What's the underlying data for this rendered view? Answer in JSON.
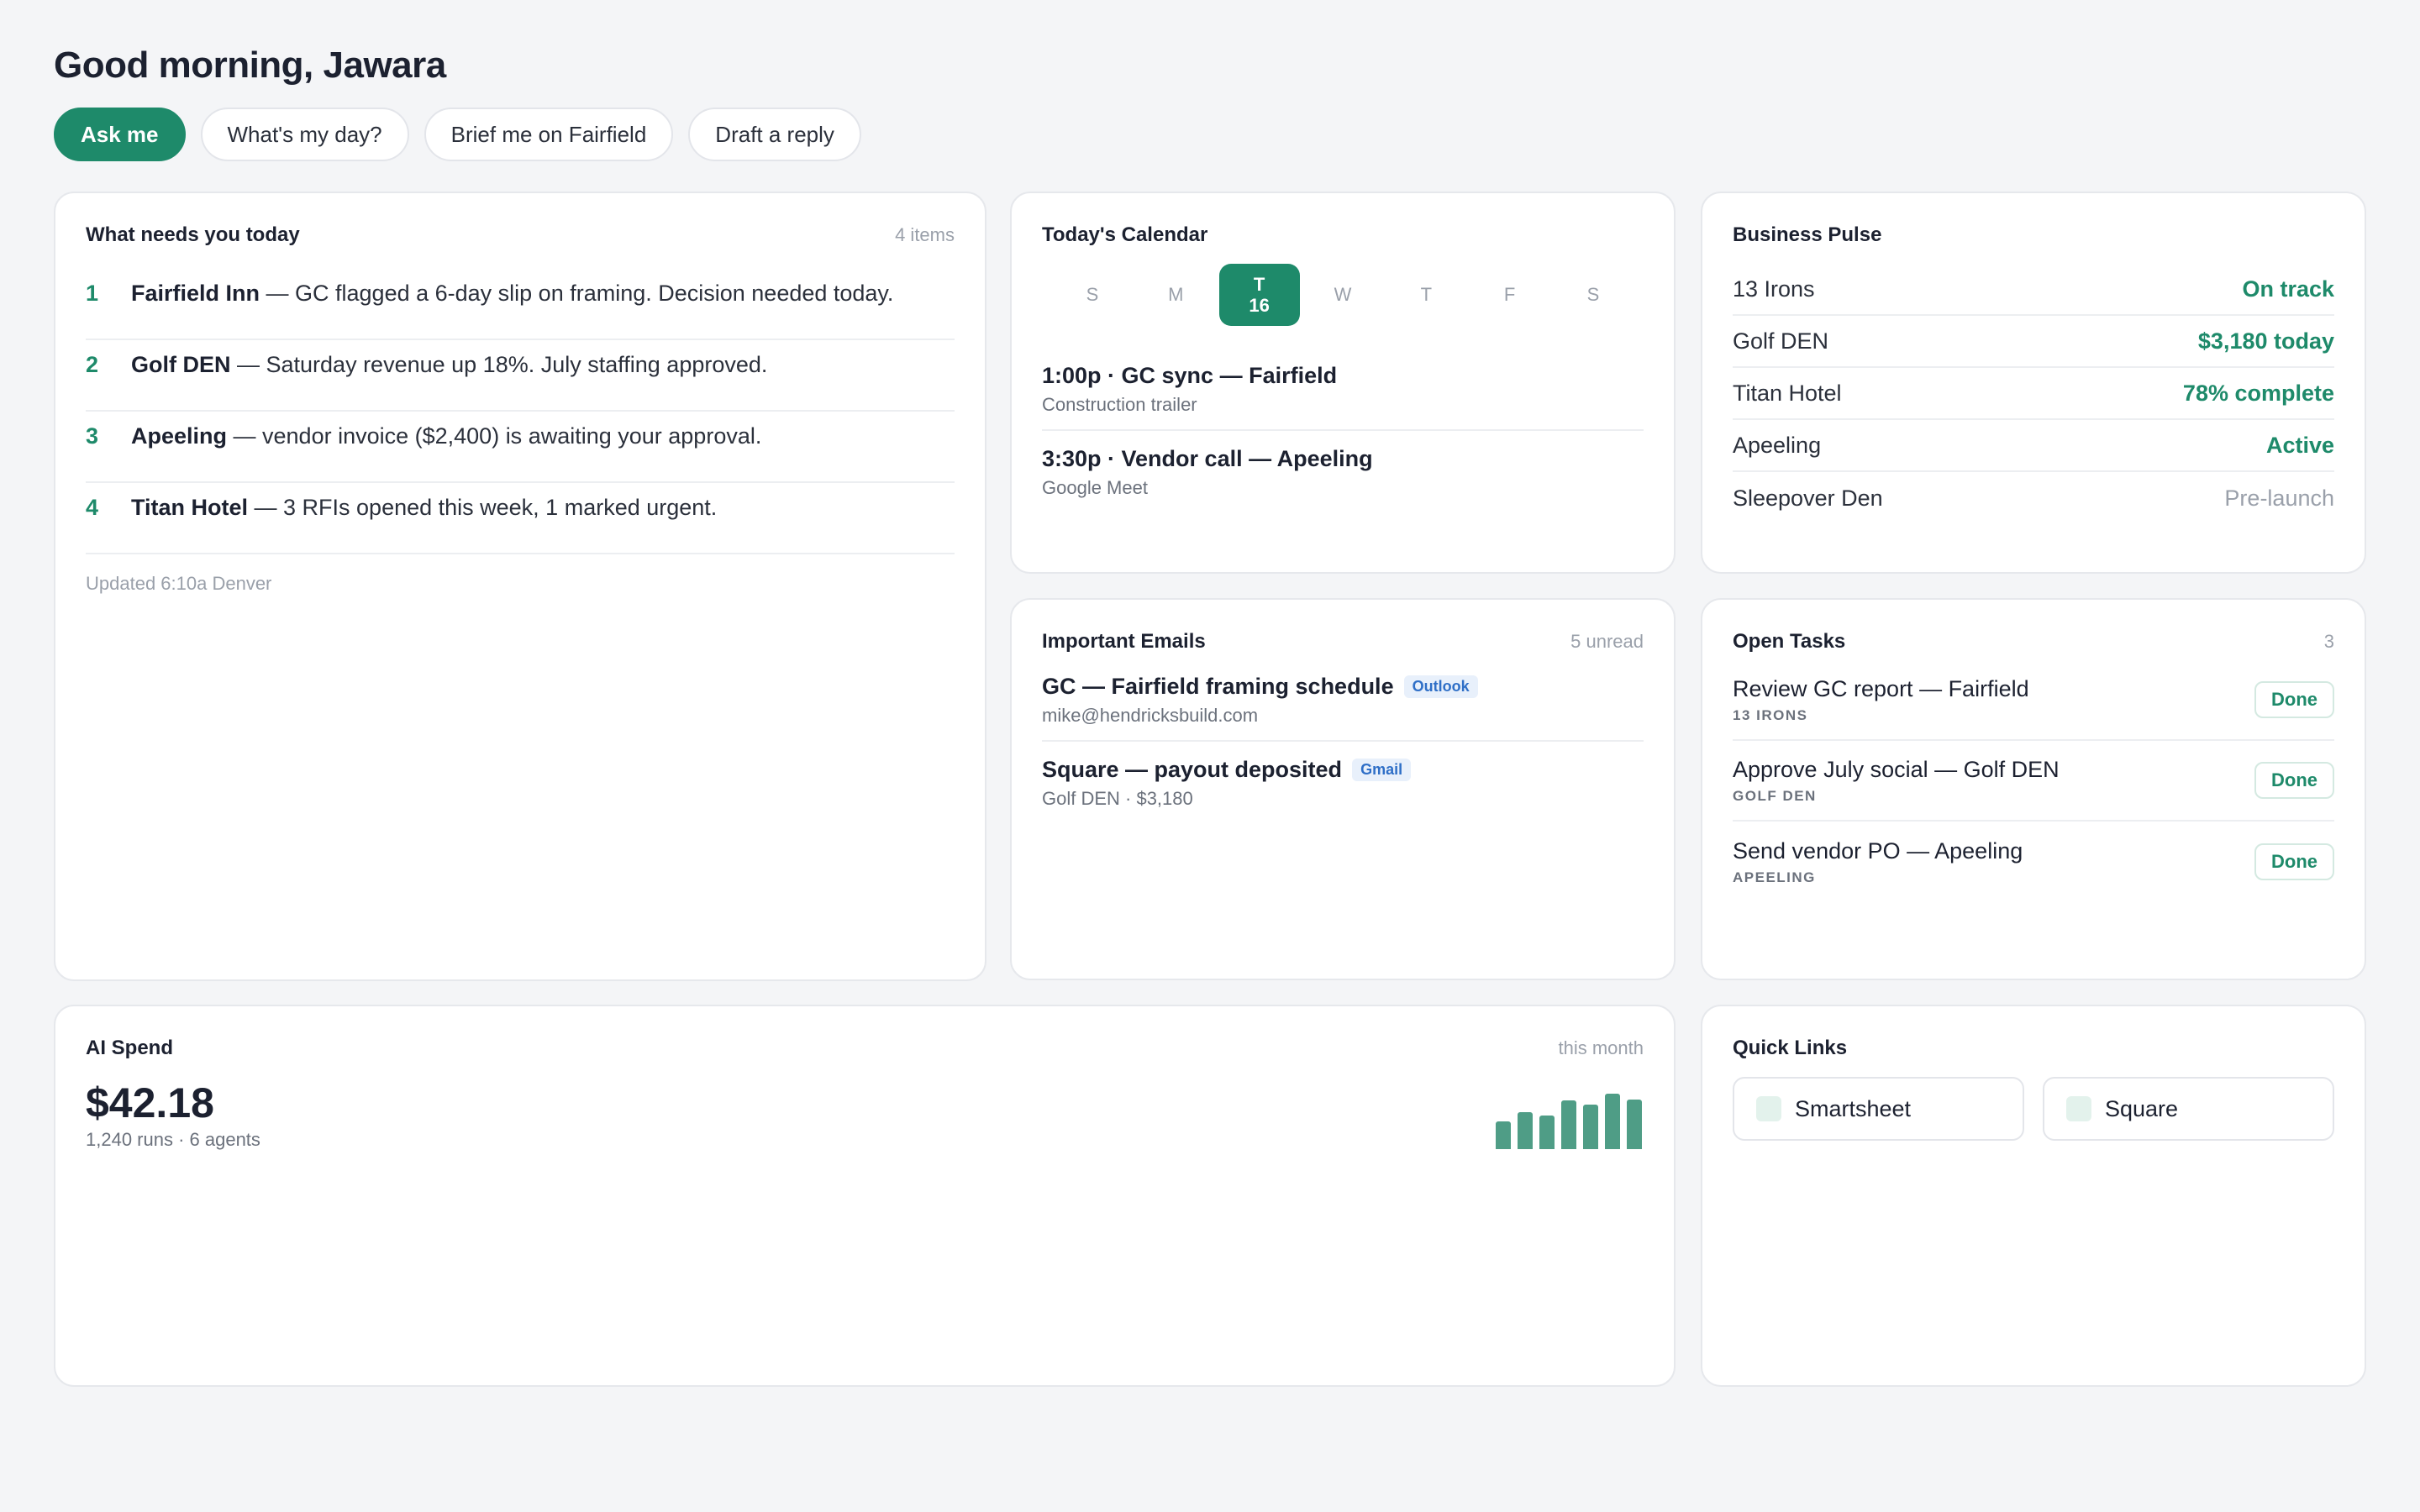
{
  "header": {
    "greeting": "Good morning, Jawara",
    "chips": [
      "Ask me",
      "What's my day?",
      "Brief me on Fairfield",
      "Draft a reply"
    ]
  },
  "needs": {
    "title": "What needs you today",
    "meta": "4 items",
    "items": [
      {
        "num": "1",
        "name": "Fairfield Inn",
        "text": " — GC flagged a 6-day slip on framing. Decision needed today."
      },
      {
        "num": "2",
        "name": "Golf DEN",
        "text": " — Saturday revenue up 18%. July staffing approved."
      },
      {
        "num": "3",
        "name": "Apeeling",
        "text": " — vendor invoice ($2,400) is awaiting your approval."
      },
      {
        "num": "4",
        "name": "Titan Hotel",
        "text": " — 3 RFIs opened this week, 1 marked urgent."
      }
    ],
    "updated": "Updated 6:10a Denver"
  },
  "calendar": {
    "title": "Today's Calendar",
    "days": [
      {
        "letter": "S",
        "num": ""
      },
      {
        "letter": "M",
        "num": ""
      },
      {
        "letter": "T",
        "num": "16"
      },
      {
        "letter": "W",
        "num": ""
      },
      {
        "letter": "T",
        "num": ""
      },
      {
        "letter": "F",
        "num": ""
      },
      {
        "letter": "S",
        "num": ""
      }
    ],
    "events": [
      {
        "title": "1:00p · GC sync — Fairfield",
        "sub": "Construction trailer"
      },
      {
        "title": "3:30p · Vendor call — Apeeling",
        "sub": "Google Meet"
      }
    ]
  },
  "pulse": {
    "title": "Business Pulse",
    "rows": [
      {
        "name": "13 Irons",
        "value": "On track",
        "status": "good"
      },
      {
        "name": "Golf DEN",
        "value": "$3,180 today",
        "status": "good"
      },
      {
        "name": "Titan Hotel",
        "value": "78% complete",
        "status": "good"
      },
      {
        "name": "Apeeling",
        "value": "Active",
        "status": "good"
      },
      {
        "name": "Sleepover Den",
        "value": "Pre-launch",
        "status": "muted"
      }
    ]
  },
  "emails": {
    "title": "Important Emails",
    "meta": "5 unread",
    "items": [
      {
        "subject": "GC — Fairfield framing schedule",
        "tag": "Outlook",
        "sub": "mike@hendricksbuild.com"
      },
      {
        "subject": "Square — payout deposited",
        "tag": "Gmail",
        "sub": "Golf DEN · $3,180"
      }
    ]
  },
  "tasks": {
    "title": "Open Tasks",
    "meta": "3",
    "items": [
      {
        "title": "Review GC report — Fairfield",
        "tag": "13 IRONS",
        "button": "Done"
      },
      {
        "title": "Approve July social — Golf DEN",
        "tag": "GOLF DEN",
        "button": "Done"
      },
      {
        "title": "Send vendor PO — Apeeling",
        "tag": "APEELING",
        "button": "Done"
      }
    ]
  },
  "spend": {
    "title": "AI Spend",
    "meta": "this month",
    "amount": "$42.18",
    "sub": "1,240 runs · 6 agents",
    "sparkline": [
      0.5,
      0.66,
      0.6,
      0.88,
      0.8,
      1.0,
      0.9
    ]
  },
  "links": {
    "title": "Quick Links",
    "items": [
      "Smartsheet",
      "Square"
    ]
  },
  "colors": {
    "accent": "#1e8a6a",
    "muted": "#9aa0aa",
    "tag_blue": "#2f6fc7"
  }
}
